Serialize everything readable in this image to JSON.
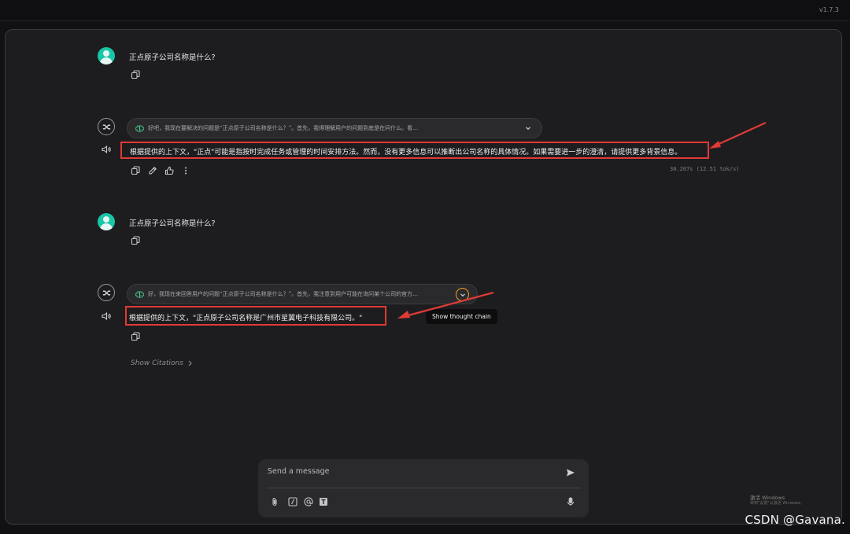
{
  "app": {
    "version": "v1.7.3"
  },
  "conversation": {
    "user_1": {
      "text": "正点原子公司名称是什么?"
    },
    "bot_1": {
      "thought_preview": "好吧，我现在要解决的问题是“正点原子公司名称是什么？”。首先，我得理解用户的问题到底是在问什么。看…",
      "answer": "根据提供的上下文，\"正点\"可能是指按时完成任务或管理的时间安排方法。然而，没有更多信息可以推断出公司名称的具体情况。如果需要进一步的澄清，请提供更多背景信息。",
      "stats": "30.207s (12.51 tok/s)"
    },
    "user_2": {
      "text": "正点原子公司名称是什么?"
    },
    "bot_2": {
      "thought_preview": "好，我现在来回答用户的问题“正点原子公司名称是什么？”。首先，我注意到用户可能在询问某个公司的官方…",
      "answer": "根据提供的上下文，\"正点原子公司名称是广州市星翼电子科技有限公司。\"",
      "tooltip": "Show thought chain",
      "citations_label": "Show Citations"
    }
  },
  "composer": {
    "placeholder": "Send a message"
  },
  "overlay": {
    "windows_watermark_title": "激活 Windows",
    "windows_watermark_sub": "转到\"设置\"以激活 Windows。",
    "csdn_watermark": "CSDN @Gavana."
  },
  "icons": {
    "user_avatar": "user-avatar-icon",
    "bot_avatar": "infinity-logo-icon",
    "copy": "copy-icon",
    "edit": "pencil-icon",
    "like": "thumbs-up-icon",
    "more": "more-vertical-icon",
    "speaker": "speaker-icon",
    "brain": "brain-icon",
    "chevron": "chevron-down-icon",
    "send": "send-icon",
    "attach": "paperclip-icon",
    "command": "slash-command-icon",
    "mention": "at-icon",
    "text": "text-format-icon",
    "mic": "microphone-icon"
  },
  "colors": {
    "accent_green": "#18c6a8",
    "annotation_red": "#e03a36",
    "highlight_orange": "#f0a020",
    "background": "#1d1d1f"
  }
}
